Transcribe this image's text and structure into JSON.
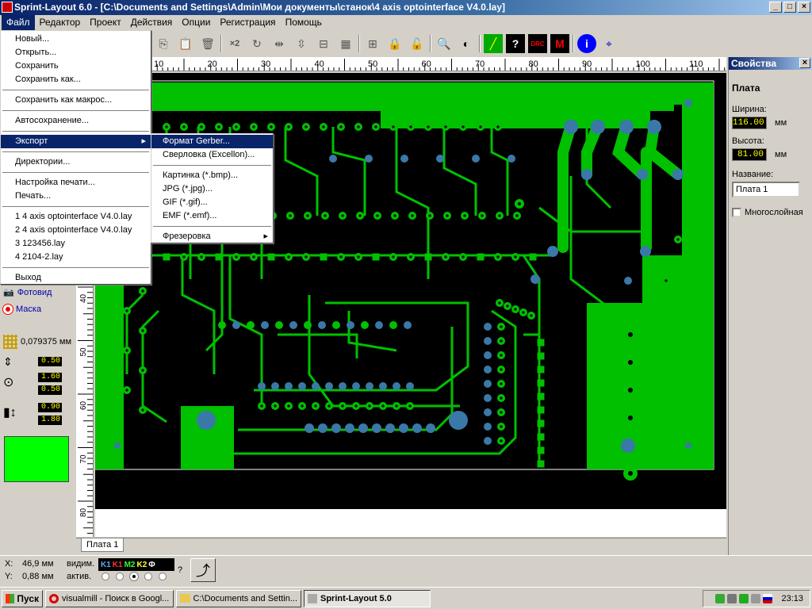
{
  "window": {
    "title": "Sprint-Layout 6.0 - [C:\\Documents and Settings\\Admin\\Мои документы\\станок\\4 axis optointerface V4.0.lay]"
  },
  "menubar": [
    "Файл",
    "Редактор",
    "Проект",
    "Действия",
    "Опции",
    "Регистрация",
    "Помощь"
  ],
  "file_menu": {
    "new": "Новый...",
    "open": "Открыть...",
    "save": "Сохранить",
    "save_as": "Сохранить как...",
    "save_macro": "Сохранить как макрос...",
    "autosave": "Автосохранение...",
    "export": "Экспорт",
    "directories": "Директории...",
    "print_setup": "Настройка печати...",
    "print": "Печать...",
    "recent1": "1 4 axis optointerface V4.0.lay",
    "recent2": "2 4 axis optointerface V4.0.lay",
    "recent3": "3 123456.lay",
    "recent4": "4 2104-2.lay",
    "exit": "Выход"
  },
  "export_menu": {
    "gerber": "Формат Gerber...",
    "excellon": "Сверловка (Excellon)...",
    "bmp": "Картинка (*.bmp)...",
    "jpg": "JPG (*.jpg)...",
    "gif": "GIF (*.gif)...",
    "emf": "EMF (*.emf)...",
    "milling": "Фрезеровка"
  },
  "ruler": {
    "top": [
      "10",
      "20",
      "30",
      "40",
      "50",
      "60",
      "70",
      "80",
      "90",
      "100",
      "110"
    ],
    "left": [
      "40",
      "50",
      "60",
      "70",
      "80"
    ]
  },
  "left_panel": {
    "photoview": "Фотовид",
    "mask": "Маска",
    "grid": "0,079375 мм",
    "track_width": "0.50",
    "pad_outer": "1.60",
    "pad_inner": "0.50",
    "smd_w": "0.90",
    "smd_h": "1.80",
    "color": "#00ff00"
  },
  "properties": {
    "title": "Свойства",
    "section": "Плата",
    "width_label": "Ширина:",
    "width_value": "116.00",
    "height_label": "Высота:",
    "height_value": "81.00",
    "unit": "мм",
    "name_label": "Название:",
    "name_value": "Плата 1",
    "multilayer": "Многослойная"
  },
  "tabs": [
    "Плата 1"
  ],
  "status": {
    "x_label": "X:",
    "x_value": "46,9 мм",
    "y_label": "Y:",
    "y_value": "0,88 мм",
    "visible_label": "видим.",
    "active_label": "актив.",
    "layers": [
      "K1",
      "K1",
      "M2",
      "K2",
      "Ф"
    ],
    "question": "?"
  },
  "taskbar": {
    "start": "Пуск",
    "tasks": [
      "visualmill - Поиск в Googl...",
      "C:\\Documents and Settin...",
      "Sprint-Layout 5.0"
    ],
    "time": "23:13"
  },
  "colors": {
    "board": "#000000",
    "copper": "#00c000",
    "pad": "#3a78a8"
  }
}
